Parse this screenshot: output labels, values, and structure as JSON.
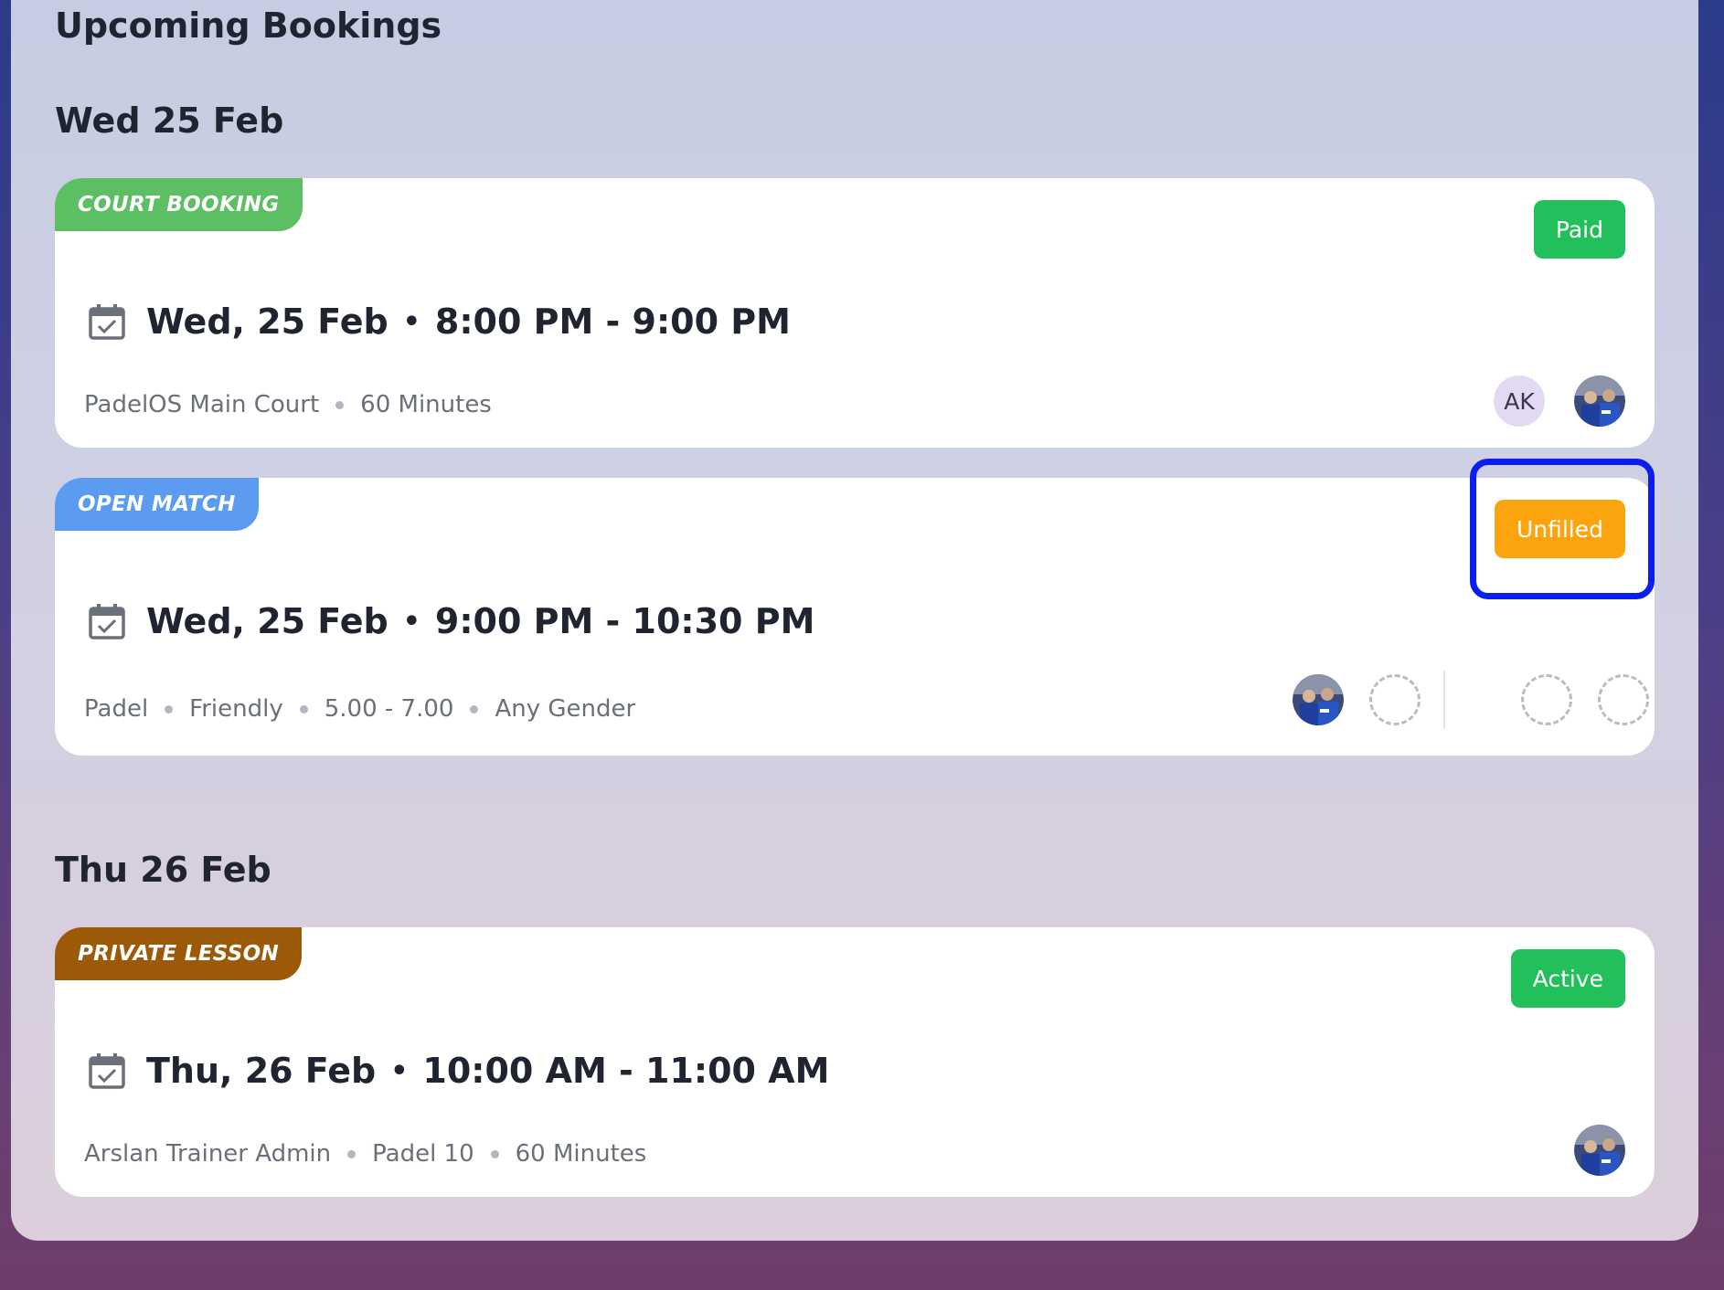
{
  "page": {
    "title": "Upcoming Bookings"
  },
  "days": [
    {
      "heading": "Wed 25 Feb",
      "bookings": [
        {
          "type_label": "COURT BOOKING",
          "type_color": "#5cbf63",
          "status": "Paid",
          "status_color": "#22c05a",
          "date": "Wed, 25 Feb",
          "time": "8:00 PM - 9:00 PM",
          "meta": [
            "PadelOS Main Court",
            "60 Minutes"
          ],
          "participants": [
            {
              "initials": "AK"
            },
            {
              "photo": true
            }
          ]
        },
        {
          "type_label": "OPEN MATCH",
          "type_color": "#5b9cf0",
          "status": "Unfilled",
          "status_color": "#fba40d",
          "date": "Wed, 25 Feb",
          "time": "9:00 PM - 10:30 PM",
          "meta": [
            "Padel",
            "Friendly",
            "5.00 - 7.00",
            "Any Gender"
          ],
          "team_a": [
            "photo",
            "empty"
          ],
          "team_b": [
            "empty",
            "empty"
          ]
        }
      ]
    },
    {
      "heading": "Thu 26 Feb",
      "bookings": [
        {
          "type_label": "PRIVATE LESSON",
          "type_color": "#9c5a08",
          "status": "Active",
          "status_color": "#22c05a",
          "date": "Thu, 26 Feb",
          "time": "10:00 AM - 11:00 AM",
          "meta": [
            "Arslan Trainer Admin",
            "Padel 10",
            "60 Minutes"
          ],
          "participants": [
            {
              "photo": true
            }
          ]
        }
      ]
    }
  ],
  "icons": {
    "date": "calendar-check-icon",
    "empty_slot": "empty-slot-icon"
  },
  "colors": {
    "focus_outline": "#0a1ef0"
  }
}
